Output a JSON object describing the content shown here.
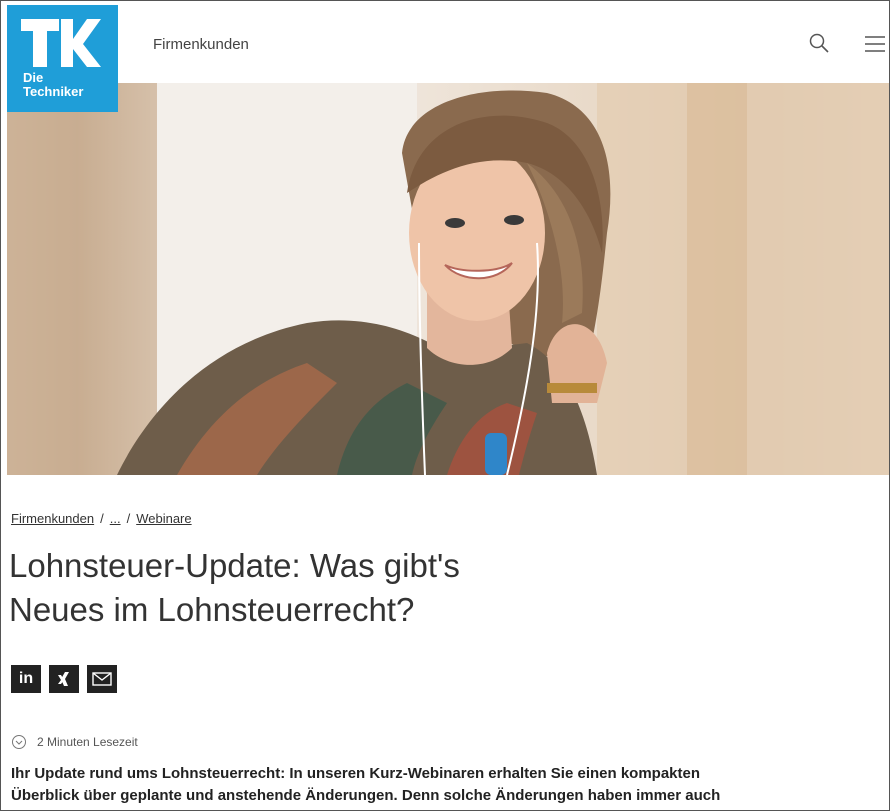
{
  "header": {
    "logo_text_line1": "Die",
    "logo_text_line2": "Techniker",
    "nav_link": "Firmenkunden",
    "search_icon": "search-icon",
    "menu_icon": "hamburger-menu-icon"
  },
  "hero": {
    "image": "smiling-woman-with-earphones"
  },
  "breadcrumb": {
    "items": [
      "Firmenkunden",
      "...",
      "Webinare"
    ],
    "separator": "/"
  },
  "page": {
    "title_line1": "Lohnsteuer-Update: Was gibt's",
    "title_line2": "Neues im Lohnsteuerrecht?",
    "reading_time": "2 Minuten Lesezeit",
    "intro_line1": "Ihr Update rund ums Lohnsteuerrecht: In unseren Kurz-Webinaren erhalten Sie einen kompakten",
    "intro_line2": "Überblick über geplante und anstehende Änderungen. Denn solche Änderungen haben immer auch"
  },
  "share": {
    "items": [
      {
        "icon": "linkedin-icon",
        "label": "in"
      },
      {
        "icon": "xing-icon",
        "label": "X"
      },
      {
        "icon": "mail-icon",
        "label": ""
      }
    ]
  },
  "colors": {
    "brand": "#1f9ed8",
    "text": "#333333",
    "icon_bg": "#222222"
  }
}
